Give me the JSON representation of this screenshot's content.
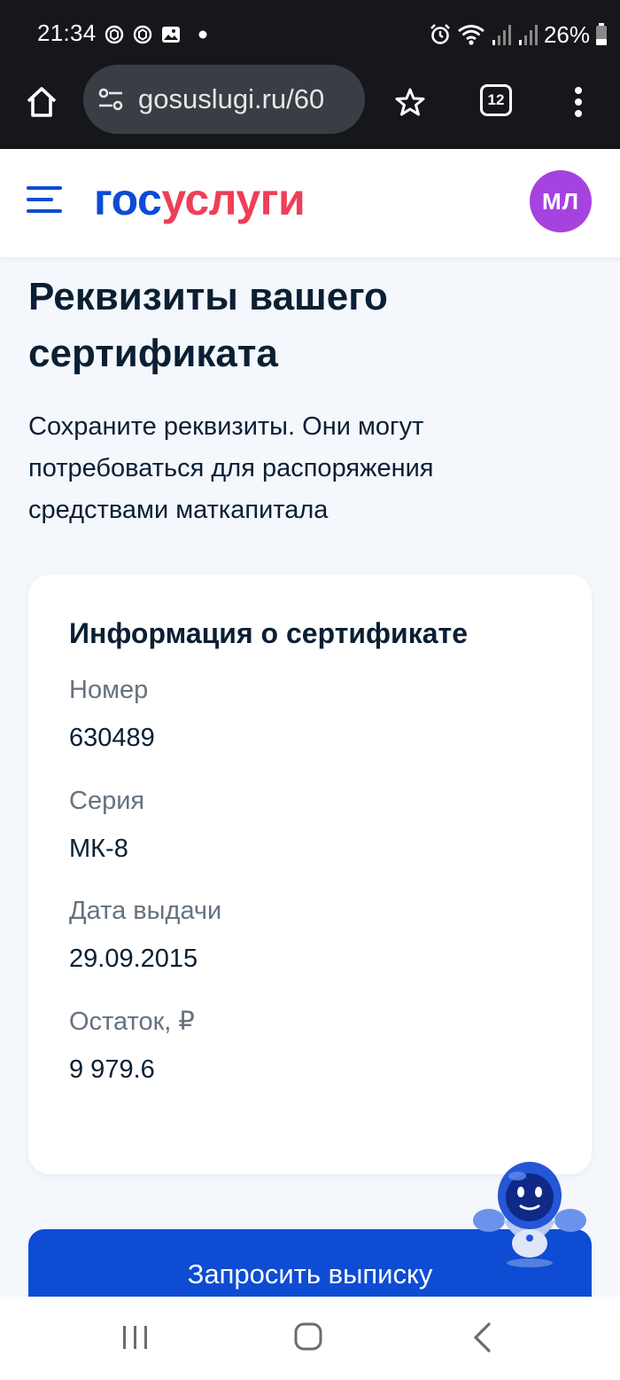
{
  "status_bar": {
    "time": "21:34",
    "battery": "26%",
    "left_icons": [
      "signal-app-icon",
      "signal-app-icon",
      "gallery-icon",
      "notification-dot-icon"
    ],
    "right_icons": [
      "alarm-icon",
      "wifi-icon",
      "cell-signal-icon",
      "cell-signal-icon",
      "battery-icon"
    ]
  },
  "browser": {
    "url": "gosuslugi.ru/60",
    "tab_count": "12",
    "icons": [
      "home-icon",
      "site-settings-icon",
      "bookmark-star-icon",
      "tabs-icon",
      "more-vert-icon"
    ]
  },
  "header": {
    "logo_part1": "гос",
    "logo_part2": "услуги",
    "avatar_initials": "МЛ",
    "colors": {
      "brand_blue": "#0d4cd3",
      "brand_red": "#ee3f58",
      "avatar_bg": "#a642e0"
    }
  },
  "page": {
    "title": "Реквизиты вашего сертификата",
    "subtitle": "Сохраните реквизиты. Они могут потребоваться для распоряжения средствами маткапитала"
  },
  "certificate_card": {
    "title": "Информация о сертификате",
    "fields": [
      {
        "label": "Номер",
        "value": "630489"
      },
      {
        "label": "Серия",
        "value": "МК-8"
      },
      {
        "label": "Дата выдачи",
        "value": "29.09.2015"
      },
      {
        "label": "Остаток, ₽",
        "value": "9 979.6"
      }
    ]
  },
  "actions": {
    "request_statement": "Запросить выписку"
  },
  "navigation": {
    "icons": [
      "recent-apps-icon",
      "home-nav-icon",
      "back-icon"
    ]
  }
}
